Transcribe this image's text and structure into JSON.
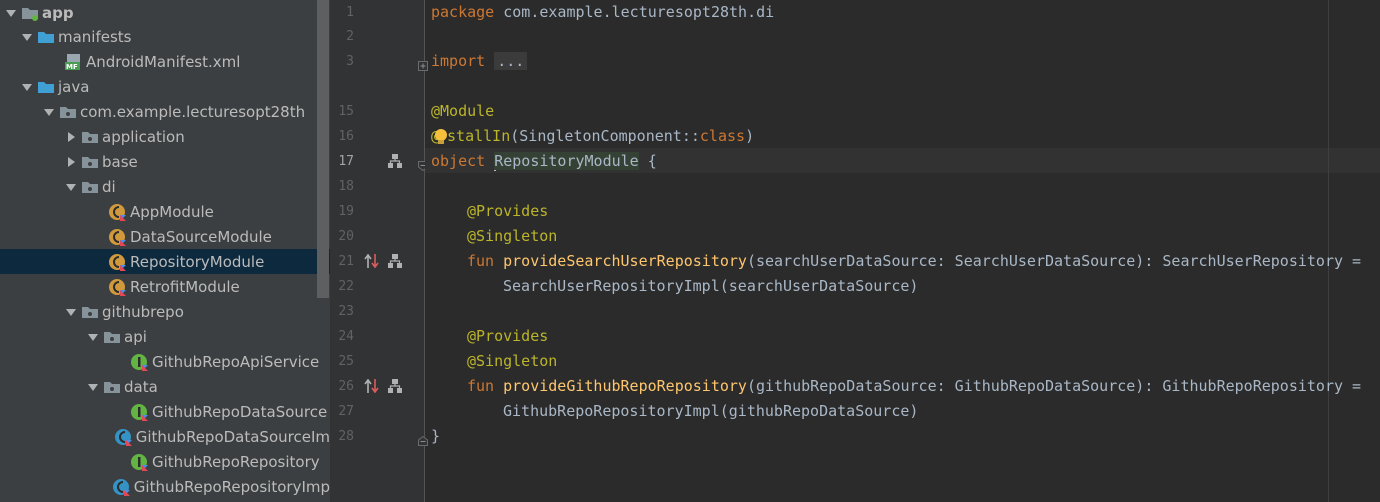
{
  "project_tree": {
    "items": [
      {
        "label": "app",
        "icon": "module-folder-icon"
      },
      {
        "label": "manifests",
        "icon": "folder-icon"
      },
      {
        "label": "AndroidManifest.xml",
        "icon": "manifest-file-icon"
      },
      {
        "label": "java",
        "icon": "folder-icon"
      },
      {
        "label": "com.example.lecturesopt28th",
        "icon": "package-icon"
      },
      {
        "label": "application",
        "icon": "package-icon"
      },
      {
        "label": "base",
        "icon": "package-icon"
      },
      {
        "label": "di",
        "icon": "package-icon"
      },
      {
        "label": "AppModule",
        "icon": "kotlin-object-icon"
      },
      {
        "label": "DataSourceModule",
        "icon": "kotlin-object-icon"
      },
      {
        "label": "RepositoryModule",
        "icon": "kotlin-object-icon"
      },
      {
        "label": "RetrofitModule",
        "icon": "kotlin-object-icon"
      },
      {
        "label": "githubrepo",
        "icon": "package-icon"
      },
      {
        "label": "api",
        "icon": "package-icon"
      },
      {
        "label": "GithubRepoApiService",
        "icon": "kotlin-interface-icon"
      },
      {
        "label": "data",
        "icon": "package-icon"
      },
      {
        "label": "GithubRepoDataSource",
        "icon": "kotlin-interface-icon"
      },
      {
        "label": "GithubRepoDataSourceIm",
        "icon": "kotlin-class-icon"
      },
      {
        "label": "GithubRepoRepository",
        "icon": "kotlin-interface-icon"
      },
      {
        "label": "GithubRepoRepositoryImp",
        "icon": "kotlin-class-icon"
      }
    ],
    "selected": "RepositoryModule"
  },
  "gutter": {
    "line_numbers": [
      "1",
      "2",
      "3",
      "15",
      "16",
      "17",
      "18",
      "19",
      "20",
      "21",
      "22",
      "23",
      "24",
      "25",
      "26",
      "27",
      "28"
    ],
    "current_line": "17"
  },
  "code": {
    "l1_kw": "package",
    "l1_rest": " com.example.lecturesopt28th.di",
    "l3_kw": "import",
    "l3_folded": "...",
    "l15_ann": "@Module",
    "l16_at": "@",
    "l16_ann": "stallIn",
    "l16_rest": "(SingletonComponent::",
    "l16_kw": "class",
    "l16_close": ")",
    "l17_kw": "object",
    "l17_name": "RepositoryModule",
    "l17_rest": " {",
    "l19_ann": "@Provides",
    "l20_ann": "@Singleton",
    "l21_kw": "fun",
    "l21_fn": "provideSearchUserRepository",
    "l21_rest": "(searchUserDataSource: SearchUserDataSource): SearchUserRepository =",
    "l22": "SearchUserRepositoryImpl(searchUserDataSource)",
    "l24_ann": "@Provides",
    "l25_ann": "@Singleton",
    "l26_kw": "fun",
    "l26_fn": "provideGithubRepoRepository",
    "l26_rest": "(githubRepoDataSource: GithubRepoDataSource): GithubRepoRepository =",
    "l27": "GithubRepoRepositoryImpl(githubRepoDataSource)",
    "l28": "}"
  },
  "colors": {
    "keyword": "#cc7832",
    "annotation": "#bbb529",
    "function": "#ffc66d",
    "default_text": "#a9b7c6",
    "selection": "#0d293e"
  }
}
